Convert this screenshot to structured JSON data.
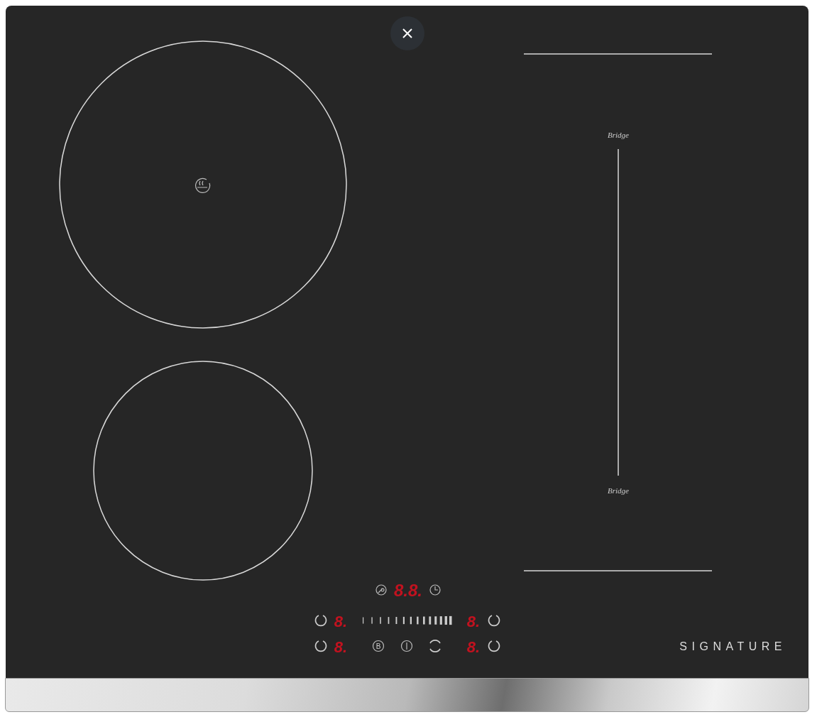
{
  "cooktop": {
    "bridge_labels": [
      "Bridge",
      "Bridge"
    ],
    "timer_display": "8.8.",
    "zone_displays": [
      {
        "text": "8."
      },
      {
        "text": "8."
      },
      {
        "text": "8."
      },
      {
        "text": "8."
      }
    ],
    "boost_key": "B",
    "brand": "SIGNATURE"
  }
}
